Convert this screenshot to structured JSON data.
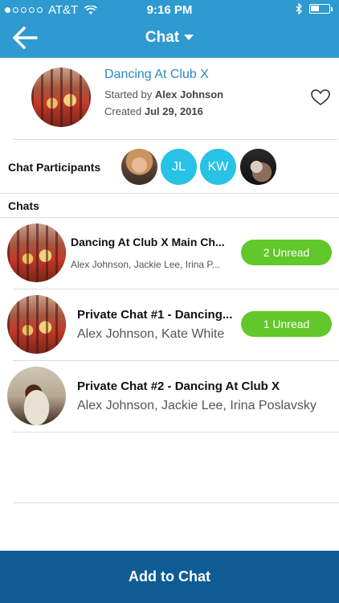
{
  "status_bar": {
    "carrier": "AT&T",
    "time": "9:16 PM"
  },
  "nav": {
    "title": "Chat"
  },
  "event": {
    "title": "Dancing At Club X",
    "started_prefix": "Started by",
    "started_by": "Alex Johnson",
    "created_prefix": "Created",
    "created_date": "Jul 29, 2016"
  },
  "participants": {
    "label": "Chat Participants",
    "initials": [
      "JL",
      "KW"
    ]
  },
  "chats_label": "Chats",
  "chats": [
    {
      "title": "Dancing At Club X Main Ch...",
      "people": "Alex Johnson, Jackie Lee, Irina P...",
      "unread": "2 Unread"
    },
    {
      "title": "Private Chat #1 - Dancing...",
      "people": "Alex Johnson, Kate White",
      "unread": "1 Unread"
    },
    {
      "title": "Private Chat #2 - Dancing At Club X",
      "people": "Alex Johnson, Jackie Lee, Irina Poslavsky"
    }
  ],
  "add_button": "Add to Chat",
  "colors": {
    "header_blue": "#2f9ad0",
    "accent_link": "#2b8ac4",
    "unread_green": "#62c72a",
    "initials_cyan": "#27c2e5",
    "bottom_button": "#0f5c94"
  },
  "icons": [
    "back-arrow-icon",
    "dropdown-caret-icon",
    "heart-icon",
    "wifi-icon",
    "bluetooth-icon",
    "battery-icon"
  ]
}
